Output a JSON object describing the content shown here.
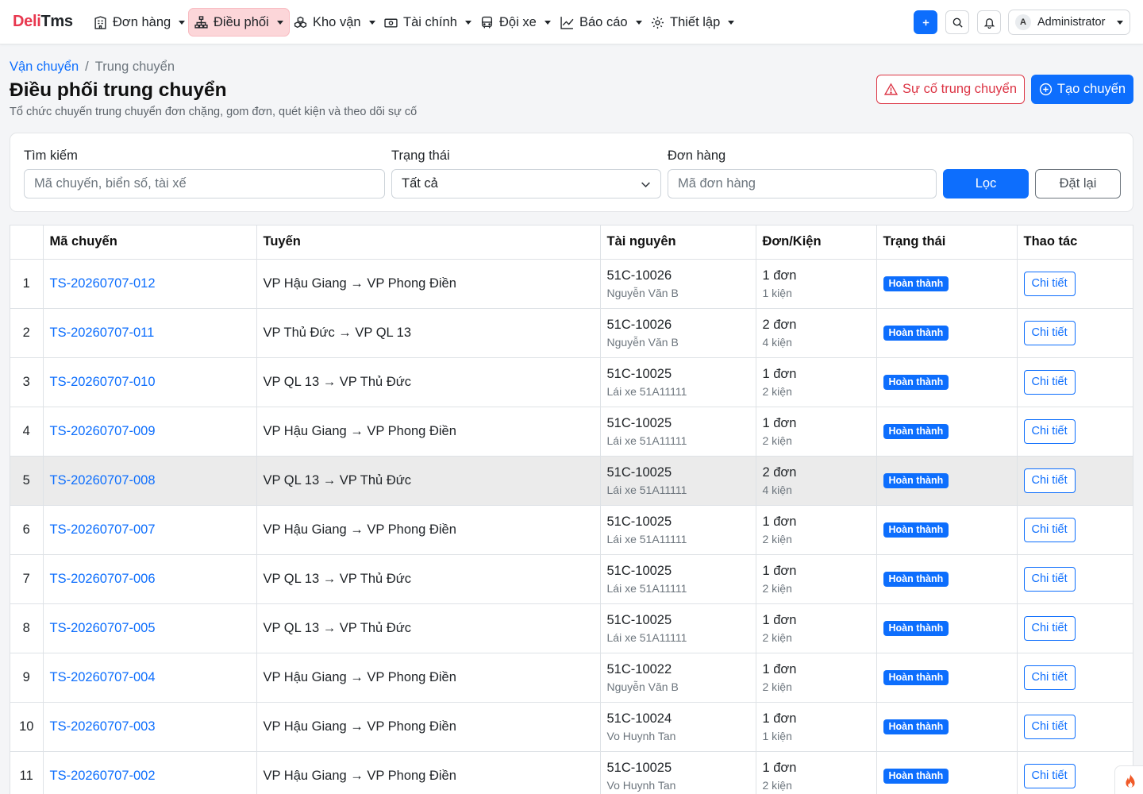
{
  "brand": {
    "part1": "Deli",
    "part2": "Tms"
  },
  "nav": [
    {
      "label": "Đơn hàng",
      "icon": "building-icon"
    },
    {
      "label": "Điều phối",
      "icon": "hierarchy-icon"
    },
    {
      "label": "Kho vận",
      "icon": "boxes-icon"
    },
    {
      "label": "Tài chính",
      "icon": "cash-icon"
    },
    {
      "label": "Đội xe",
      "icon": "bus-icon"
    },
    {
      "label": "Báo cáo",
      "icon": "chart-line-icon"
    },
    {
      "label": "Thiết lập",
      "icon": "gear-icon"
    }
  ],
  "user": {
    "initial": "A",
    "name": "Administrator"
  },
  "breadcrumb": {
    "parent": "Vận chuyển",
    "separator": "/",
    "current": "Trung chuyển"
  },
  "page": {
    "title": "Điều phối trung chuyển",
    "subtitle": "Tổ chức chuyến trung chuyển đơn chặng, gom đơn, quét kiện và theo dõi sự cố",
    "incident_button": "Sự cố trung chuyển",
    "create_button": "Tạo chuyến"
  },
  "filters": {
    "search_label": "Tìm kiếm",
    "search_placeholder": "Mã chuyến, biển số, tài xế",
    "status_label": "Trạng thái",
    "status_value": "Tất cả",
    "order_label": "Đơn hàng",
    "order_placeholder": "Mã đơn hàng",
    "filter_button": "Lọc",
    "reset_button": "Đặt lại"
  },
  "table": {
    "headers": [
      "",
      "Mã chuyến",
      "Tuyến",
      "Tài nguyên",
      "Đơn/Kiện",
      "Trạng thái",
      "Thao tác"
    ],
    "action_label": "Chi tiết",
    "rows": [
      {
        "no": "1",
        "code": "TS-20260707-012",
        "route": "VP Hậu Giang → VP Phong Điền",
        "plate": "51C-10026",
        "driver": "Nguyễn Văn B",
        "orders": "1 đơn",
        "packages": "1 kiện",
        "status": "Hoàn thành"
      },
      {
        "no": "2",
        "code": "TS-20260707-011",
        "route": "VP Thủ Đức → VP QL 13",
        "plate": "51C-10026",
        "driver": "Nguyễn Văn B",
        "orders": "2 đơn",
        "packages": "4 kiện",
        "status": "Hoàn thành"
      },
      {
        "no": "3",
        "code": "TS-20260707-010",
        "route": "VP QL 13 → VP Thủ Đức",
        "plate": "51C-10025",
        "driver": "Lái xe 51A11111",
        "orders": "1 đơn",
        "packages": "2 kiện",
        "status": "Hoàn thành"
      },
      {
        "no": "4",
        "code": "TS-20260707-009",
        "route": "VP Hậu Giang → VP Phong Điền",
        "plate": "51C-10025",
        "driver": "Lái xe 51A11111",
        "orders": "1 đơn",
        "packages": "2 kiện",
        "status": "Hoàn thành"
      },
      {
        "no": "5",
        "code": "TS-20260707-008",
        "route": "VP QL 13 → VP Thủ Đức",
        "plate": "51C-10025",
        "driver": "Lái xe 51A11111",
        "orders": "2 đơn",
        "packages": "4 kiện",
        "status": "Hoàn thành"
      },
      {
        "no": "6",
        "code": "TS-20260707-007",
        "route": "VP Hậu Giang → VP Phong Điền",
        "plate": "51C-10025",
        "driver": "Lái xe 51A11111",
        "orders": "1 đơn",
        "packages": "2 kiện",
        "status": "Hoàn thành"
      },
      {
        "no": "7",
        "code": "TS-20260707-006",
        "route": "VP QL 13 → VP Thủ Đức",
        "plate": "51C-10025",
        "driver": "Lái xe 51A11111",
        "orders": "1 đơn",
        "packages": "2 kiện",
        "status": "Hoàn thành"
      },
      {
        "no": "8",
        "code": "TS-20260707-005",
        "route": "VP QL 13 → VP Thủ Đức",
        "plate": "51C-10025",
        "driver": "Lái xe 51A11111",
        "orders": "1 đơn",
        "packages": "2 kiện",
        "status": "Hoàn thành"
      },
      {
        "no": "9",
        "code": "TS-20260707-004",
        "route": "VP Hậu Giang → VP Phong Điền",
        "plate": "51C-10022",
        "driver": "Nguyễn Văn B",
        "orders": "1 đơn",
        "packages": "2 kiện",
        "status": "Hoàn thành"
      },
      {
        "no": "10",
        "code": "TS-20260707-003",
        "route": "VP Hậu Giang → VP Phong Điền",
        "plate": "51C-10024",
        "driver": "Vo Huynh Tan",
        "orders": "1 đơn",
        "packages": "1 kiện",
        "status": "Hoàn thành"
      },
      {
        "no": "11",
        "code": "TS-20260707-002",
        "route": "VP Hậu Giang → VP Phong Điền",
        "plate": "51C-10025",
        "driver": "Vo Huynh Tan",
        "orders": "1 đơn",
        "packages": "2 kiện",
        "status": "Hoàn thành"
      }
    ]
  },
  "colors": {
    "primary": "#0d6efd",
    "danger": "#dc3545",
    "brand_red": "#e8384f",
    "active_nav": "#fcd6d9"
  }
}
